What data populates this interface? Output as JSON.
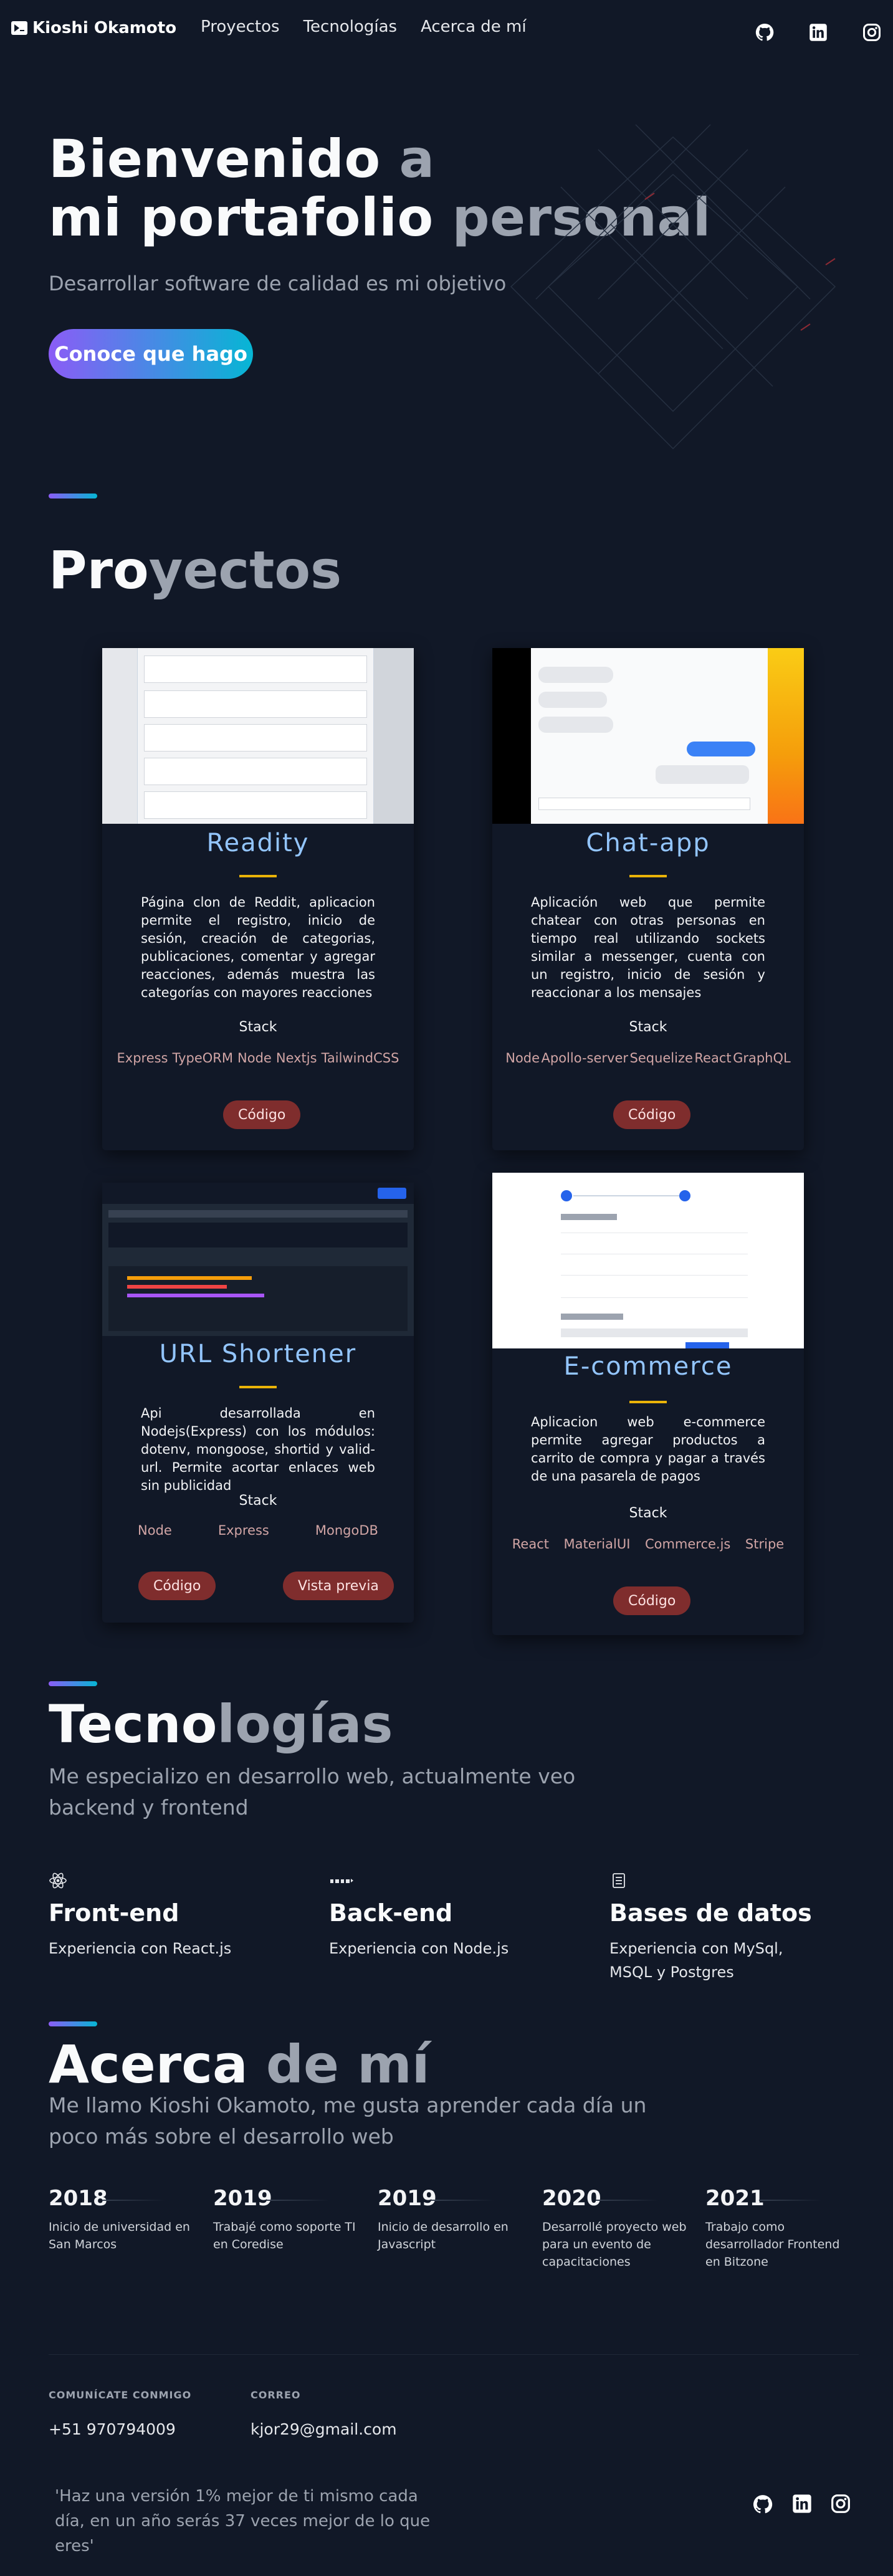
{
  "nav": {
    "logo_text": "Kioshi Okamoto",
    "links": [
      "Proyectos",
      "Tecnologías",
      "Acerca de mí"
    ],
    "icons": [
      "github-icon",
      "linkedin-icon",
      "instagram-icon"
    ]
  },
  "hero": {
    "title_line1_a": "Bienvenido",
    "title_line1_b": " a",
    "title_line2_a": "mi portafolio",
    "title_line2_b": " personal",
    "subtitle": "Desarrollar software de calidad es mi objetivo",
    "cta": "Conoce que hago"
  },
  "projects": {
    "title_a": "Pro",
    "title_b": "yectos",
    "stack_label": "Stack",
    "items": [
      {
        "title": "Readity",
        "description": "Página clon de Reddit, aplicacion permite el registro, inicio de sesión, creación de categorias, publicaciones, comentar y agregar reacciones, además muestra las categorías con mayores reacciones",
        "stack": [
          "Express",
          "TypeORM",
          "Node",
          "Nextjs",
          "TailwindCSS"
        ],
        "buttons": [
          "Código"
        ]
      },
      {
        "title": "Chat-app",
        "description": "Aplicación web que permite chatear con otras personas en tiempo real utilizando sockets similar a messenger, cuenta con un registro, inicio de sesión y reaccionar a los mensajes",
        "stack": [
          "Node",
          "Apollo-server",
          "Sequelize",
          "React",
          "GraphQL"
        ],
        "buttons": [
          "Código"
        ]
      },
      {
        "title": "URL Shortener",
        "description": "Api desarrollada en Nodejs(Express) con los módulos: dotenv, mongoose, shortid y valid-url. Permite acortar enlaces web sin publicidad",
        "stack": [
          "Node",
          "Express",
          "MongoDB"
        ],
        "buttons": [
          "Código",
          "Vista previa"
        ]
      },
      {
        "title": "E-commerce",
        "description": "Aplicacion web e-commerce permite agregar productos a carrito de compra y pagar a través de una pasarela de pagos",
        "stack": [
          "React",
          "MaterialUI",
          "Commerce.js",
          "Stripe"
        ],
        "buttons": [
          "Código"
        ]
      }
    ]
  },
  "tech": {
    "title_a": "Tecno",
    "title_b": "logías",
    "subtitle": "Me especializo en desarrollo web, actualmente veo backend y frontend",
    "columns": [
      {
        "icon": "react-icon",
        "title": "Front-end",
        "body": "Experiencia con React.js"
      },
      {
        "icon": "node-icon",
        "title": "Back-end",
        "body": "Experiencia con Node.js"
      },
      {
        "icon": "database-icon",
        "title": "Bases de datos",
        "body": "Experiencia con MySql, MSQL y Postgres"
      }
    ]
  },
  "about": {
    "title_a": "Acerca",
    "title_b": " de mí",
    "subtitle": "Me llamo Kioshi Okamoto, me gusta aprender cada día un poco más sobre el desarrollo web",
    "timeline": [
      {
        "year": "2018",
        "text": "Inicio de universidad en San Marcos"
      },
      {
        "year": "2019",
        "text": "Trabajé como soporte TI en Coredise"
      },
      {
        "year": "2019",
        "text": "Inicio de desarrollo en Javascript"
      },
      {
        "year": "2020",
        "text": "Desarrollé proyecto web para un evento de capacitaciones"
      },
      {
        "year": "2021",
        "text": "Trabajo como desarrollador Frontend en Bitzone"
      }
    ]
  },
  "footer": {
    "contact_label": "COMUNÍCATE CONMIGO",
    "contact_value": "+51 970794009",
    "email_label": "CORREO",
    "email_value": "kjor29@gmail.com",
    "quote": "'Haz una versión 1% mejor de ti mismo cada día, en un año serás 37 veces mejor de lo que eres'"
  },
  "colors": {
    "background": "#111827",
    "accent_start": "#8b5cf6",
    "accent_end": "#06b6d4",
    "card_title": "#93c5fd",
    "card_rule": "#eab308",
    "button": "#7f2d2d"
  }
}
